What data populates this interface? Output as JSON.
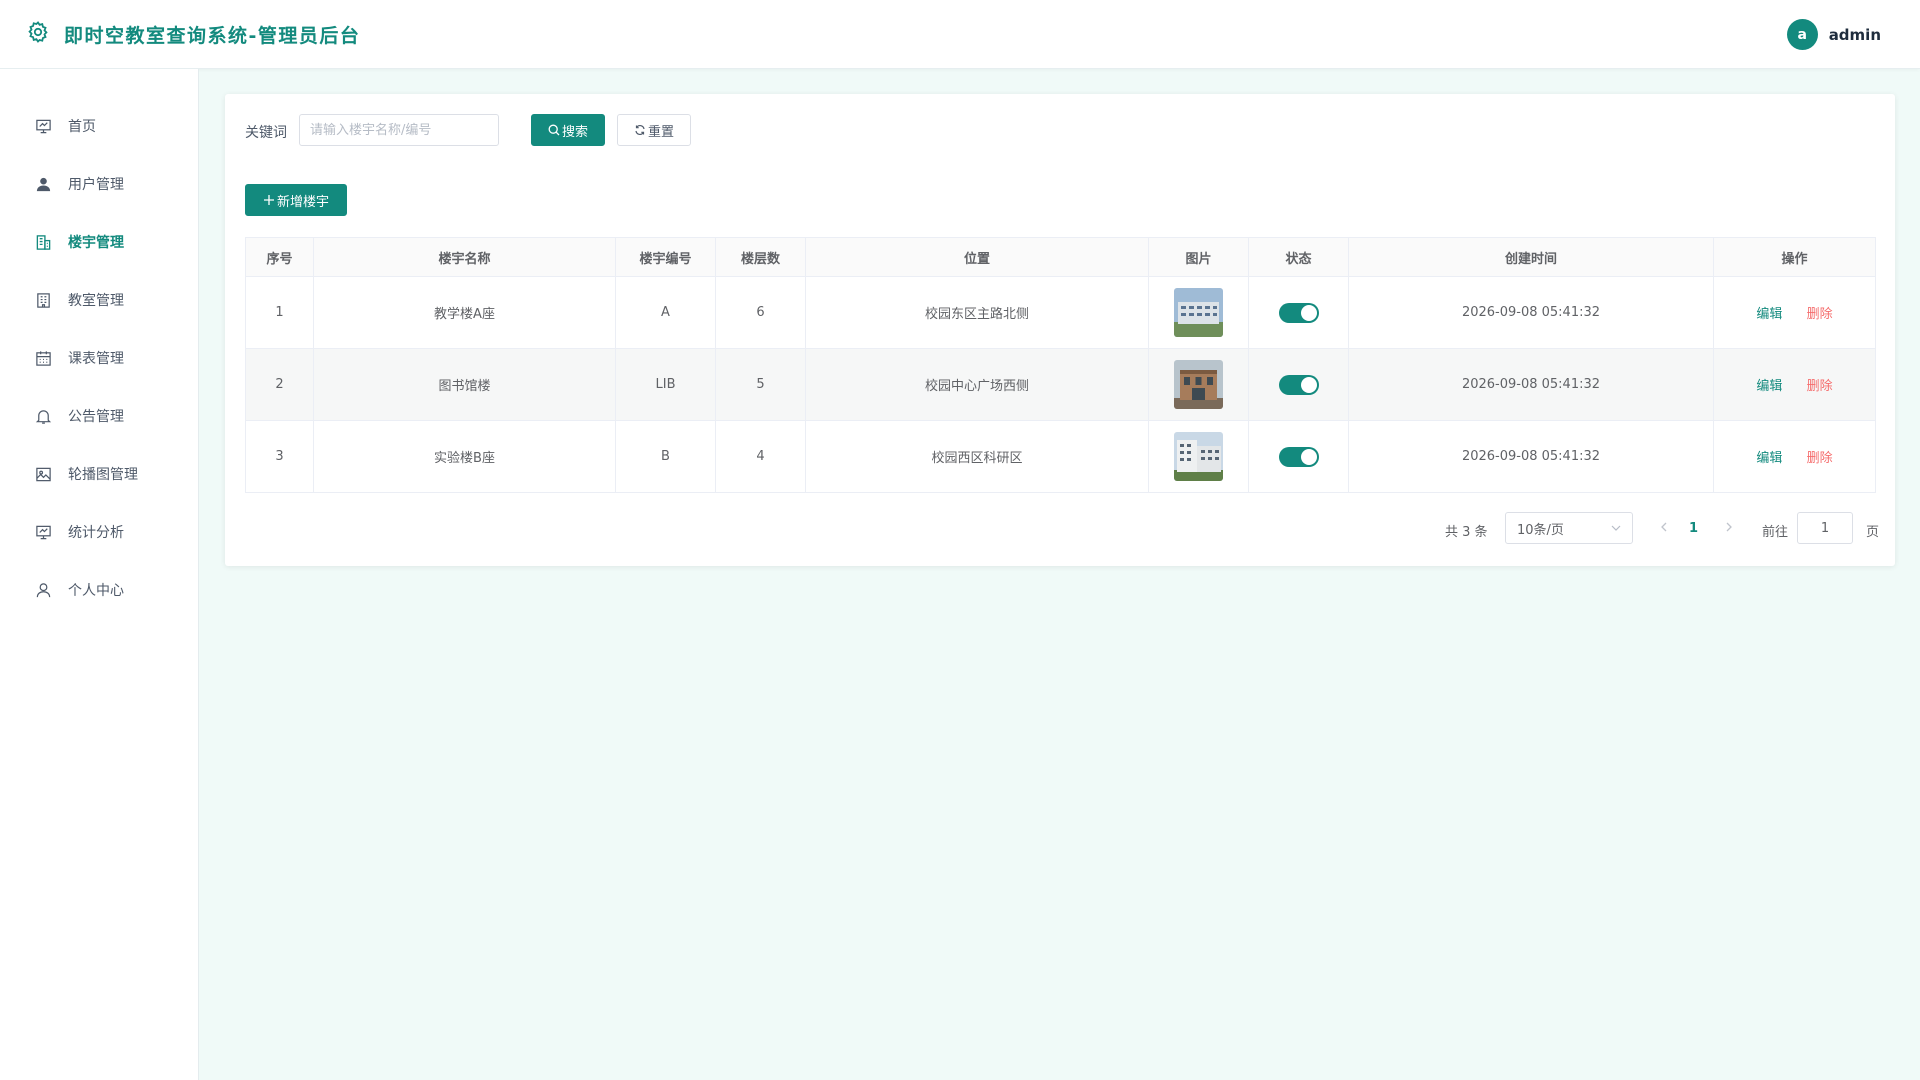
{
  "header": {
    "title": "即时空教室查询系统-管理员后台",
    "avatar_letter": "a",
    "username": "admin",
    "accent": "#138a7e"
  },
  "sidebar": {
    "items": [
      {
        "label": "首页",
        "icon": "dashboard-icon"
      },
      {
        "label": "用户管理",
        "icon": "user-icon"
      },
      {
        "label": "楼宇管理",
        "icon": "building-icon",
        "active": true
      },
      {
        "label": "教室管理",
        "icon": "classroom-icon"
      },
      {
        "label": "课表管理",
        "icon": "calendar-icon"
      },
      {
        "label": "公告管理",
        "icon": "bell-icon"
      },
      {
        "label": "轮播图管理",
        "icon": "image-icon"
      },
      {
        "label": "统计分析",
        "icon": "chart-icon"
      },
      {
        "label": "个人中心",
        "icon": "person-icon"
      }
    ]
  },
  "search": {
    "label": "关键词",
    "placeholder": "请输入楼宇名称/编号",
    "value": "",
    "search_label": "搜索",
    "reset_label": "重置"
  },
  "toolbar": {
    "add_label": "新增楼宇"
  },
  "table": {
    "columns": [
      "序号",
      "楼宇名称",
      "楼宇编号",
      "楼层数",
      "位置",
      "图片",
      "状态",
      "创建时间",
      "操作"
    ],
    "rows": [
      {
        "index": "1",
        "name": "教学楼A座",
        "code": "A",
        "floors": "6",
        "location": "校园东区主路北侧",
        "status_on": true,
        "created": "2026-09-08 05:41:32"
      },
      {
        "index": "2",
        "name": "图书馆楼",
        "code": "LIB",
        "floors": "5",
        "location": "校园中心广场西侧",
        "status_on": true,
        "created": "2026-09-08 05:41:32"
      },
      {
        "index": "3",
        "name": "实验楼B座",
        "code": "B",
        "floors": "4",
        "location": "校园西区科研区",
        "status_on": true,
        "created": "2026-09-08 05:41:32"
      }
    ],
    "edit_label": "编辑",
    "delete_label": "删除"
  },
  "pagination": {
    "total_text": "共 3 条",
    "page_size": "10条/页",
    "current_page": "1",
    "goto_label": "前往",
    "goto_value": "1",
    "goto_suffix": "页"
  }
}
